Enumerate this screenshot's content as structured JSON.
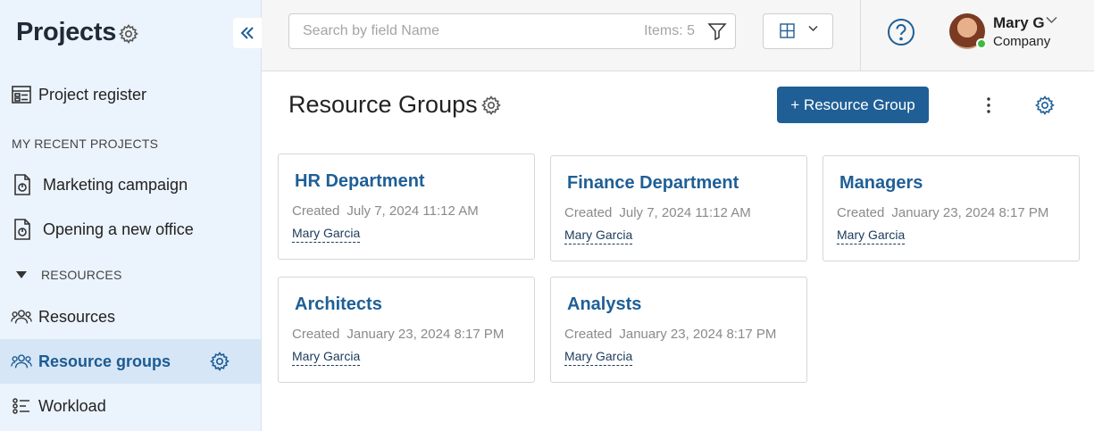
{
  "sidebar": {
    "title": "Projects",
    "items": [
      {
        "label": "Project register"
      },
      {
        "label": "Marketing campaign"
      },
      {
        "label": "Opening a new office"
      },
      {
        "label": "Resources"
      },
      {
        "label": "Resource groups"
      },
      {
        "label": "Workload"
      }
    ],
    "section_recent": "MY RECENT PROJECTS",
    "section_resources": "RESOURCES"
  },
  "topbar": {
    "search_placeholder": "Search by field Name",
    "items_count": "Items: 5",
    "user": {
      "name": "Mary G",
      "company": "Company"
    }
  },
  "main": {
    "title": "Resource Groups",
    "add_button": "+ Resource Group",
    "cards": [
      {
        "title": "HR Department",
        "created_label": "Created",
        "created": "July 7, 2024 11:12 AM",
        "user": "Mary Garcia"
      },
      {
        "title": "Finance Department",
        "created_label": "Created",
        "created": "July 7, 2024 11:12 AM",
        "user": "Mary Garcia"
      },
      {
        "title": "Managers",
        "created_label": "Created",
        "created": "January 23, 2024 8:17 PM",
        "user": "Mary Garcia"
      },
      {
        "title": "Architects",
        "created_label": "Created",
        "created": "January 23, 2024 8:17 PM",
        "user": "Mary Garcia"
      },
      {
        "title": "Analysts",
        "created_label": "Created",
        "created": "January 23, 2024 8:17 PM",
        "user": "Mary Garcia"
      }
    ]
  },
  "colors": {
    "accent": "#1f5f96",
    "sidebar_bg": "#ebf3fc",
    "active_bg": "#d6e6f6",
    "online": "#3dbb3d"
  }
}
